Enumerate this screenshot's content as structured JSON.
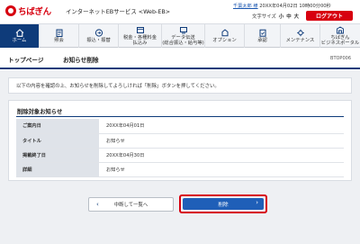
{
  "header": {
    "logo_text": "ちばぎん",
    "service_name": "インターネットEBサービス <Web-EB>",
    "user_name": "千葉太郎 様",
    "last_login": "20XX年04月02日 10時00分00秒",
    "font_size_label": "文字サイズ",
    "font_sizes": [
      "小",
      "中",
      "大"
    ],
    "logout_label": "ログアウト"
  },
  "nav": {
    "items": [
      {
        "label": "ホーム",
        "icon": "home-icon",
        "active": true
      },
      {
        "label": "照会",
        "icon": "inquiry-icon"
      },
      {
        "label": "振込・振替",
        "icon": "transfer-icon"
      },
      {
        "label": "税金・各種料金\n払込み",
        "icon": "tax-payment-icon"
      },
      {
        "label": "データ伝送\n(総合振込・給与等)",
        "icon": "data-transfer-icon"
      },
      {
        "label": "オプション",
        "icon": "option-icon"
      },
      {
        "label": "承認",
        "icon": "approval-icon"
      },
      {
        "label": "メンテナンス",
        "icon": "maintenance-icon"
      },
      {
        "label": "ちばぎん\nビジネスポータル",
        "icon": "portal-icon"
      }
    ]
  },
  "page": {
    "breadcrumb": "トップページ",
    "title": "お知らせ削除",
    "screen_code": "BTOP006",
    "instruction": "以下の内容を確認の上、お知らせを削除してよろしければ「削除」ボタンを押してください。"
  },
  "panel": {
    "title": "削除対象お知らせ",
    "rows": [
      {
        "label": "ご案内日",
        "value": "20XX年04月01日"
      },
      {
        "label": "タイトル",
        "value": "お知らせ"
      },
      {
        "label": "掲載終了日",
        "value": "20XX年04月30日"
      },
      {
        "label": "詳細",
        "value": "お知らせ"
      }
    ]
  },
  "actions": {
    "back_label": "中断して一覧へ",
    "delete_label": "削除"
  },
  "colors": {
    "brand_red": "#d7000f",
    "navy": "#0e3b7a",
    "button_blue": "#1f5fb8"
  }
}
